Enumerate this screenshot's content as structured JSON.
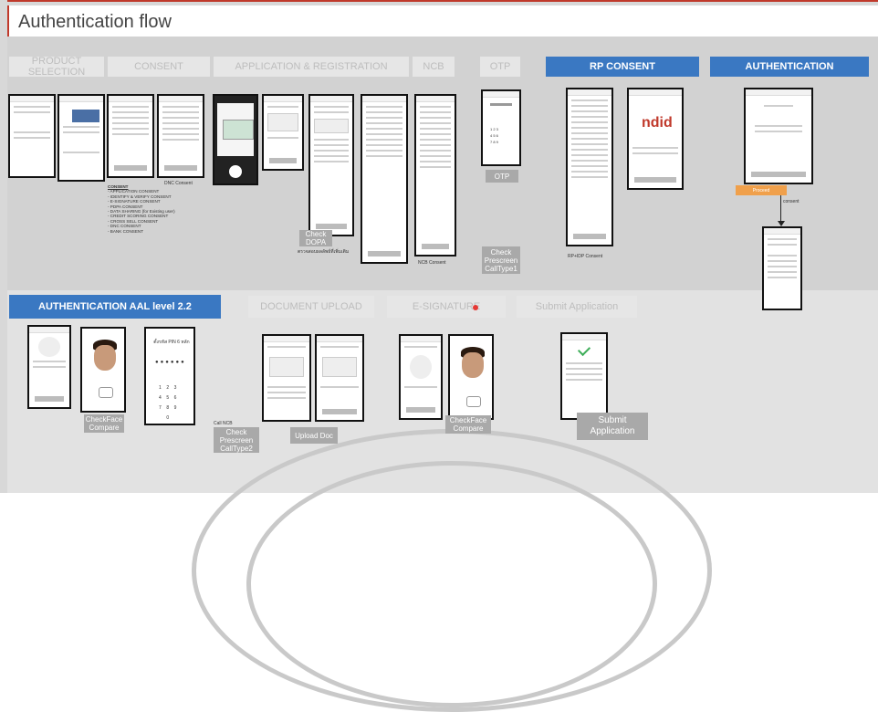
{
  "title": "Authentication flow",
  "headers_top": [
    {
      "label": "PRODUCT SELECTION",
      "style": "faded"
    },
    {
      "label": "CONSENT",
      "style": "faded"
    },
    {
      "label": "APPLICATION & REGISTRATION",
      "style": "faded"
    },
    {
      "label": "NCB",
      "style": "faded"
    },
    {
      "label": "OTP",
      "style": "faded"
    },
    {
      "label": "RP CONSENT",
      "style": "blue"
    },
    {
      "label": "AUTHENTICATION",
      "style": "blue"
    }
  ],
  "headers_bottom": [
    {
      "label": "AUTHENTICATION AAL level 2.2",
      "style": "blue"
    },
    {
      "label": "DOCUMENT UPLOAD",
      "style": "faded"
    },
    {
      "label": "E-SIGNATURE",
      "style": "faded"
    },
    {
      "label": "Submit Application",
      "style": "faded"
    }
  ],
  "captions": {
    "dnc_consent": "DNC Consent",
    "ncb_consent": "NCB Consent",
    "rp_idp_consent": "RP+IDP Consent",
    "consent_list_title": "CONSENT",
    "consent_list": [
      "- APPLICATION CONSENT",
      "- IDENTIFY & VERIFY CONSENT",
      "- E-SIGNATURE CONSENT",
      "- PDPA CONSENT",
      "- DATA SHARING (for Existing user)",
      "- CREDIT SCORING CONSENT",
      "- CROSS SELL CONSENT",
      "- DNC CONSENT",
      "- BANK CONSENT"
    ],
    "check_dopa_note": "ตรวจสอบผลลัพธ์ที่เพิ่มเติม",
    "call_ncb": "Call NCB",
    "consent_link": "consent"
  },
  "label_boxes": {
    "check_dopa": "Check DOPA",
    "otp": "OTP",
    "check_prescreen_1": "Check Prescreen CallType1",
    "checkface_1": "CheckFace Compare",
    "check_prescreen_2": "Check Prescreen CallType2",
    "upload_doc": "Upload Doc",
    "checkface_2": "CheckFace Compare",
    "submit_application": "Submit Application",
    "proceed": "Proceed"
  },
  "logo_text": "ndid",
  "pin_title": "ตั้งรหัส PIN 6 หลัก",
  "colors": {
    "accent_blue": "#3a78c2",
    "label_grey": "#a9a9a9",
    "orange": "#f0a04b",
    "title_red": "#c0392b"
  }
}
